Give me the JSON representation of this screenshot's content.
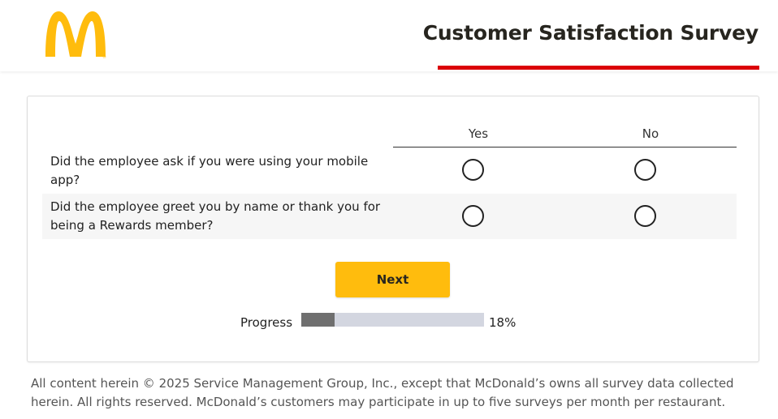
{
  "header": {
    "title": "Customer Satisfaction Survey",
    "logo_icon": "golden-arches-logo",
    "brand_yellow": "#ffbc0d",
    "brand_red": "#db0007"
  },
  "survey": {
    "columns": [
      "Yes",
      "No"
    ],
    "questions": [
      {
        "text": "Did the employee ask if you were using your mobile app?"
      },
      {
        "text": "Did the employee greet you by name or thank you for being a Rewards member?"
      }
    ],
    "next_label": "Next",
    "next_color": "#ffbc0d",
    "progress_label": "Progress",
    "progress_value": "18%",
    "progress_fraction": 0.18
  },
  "footer": {
    "text": "All content herein © 2025 Service Management Group, Inc., except that McDonald’s owns all survey data collected herein. All rights reserved. McDonald’s customers may participate in up to five surveys per month per restaurant."
  }
}
